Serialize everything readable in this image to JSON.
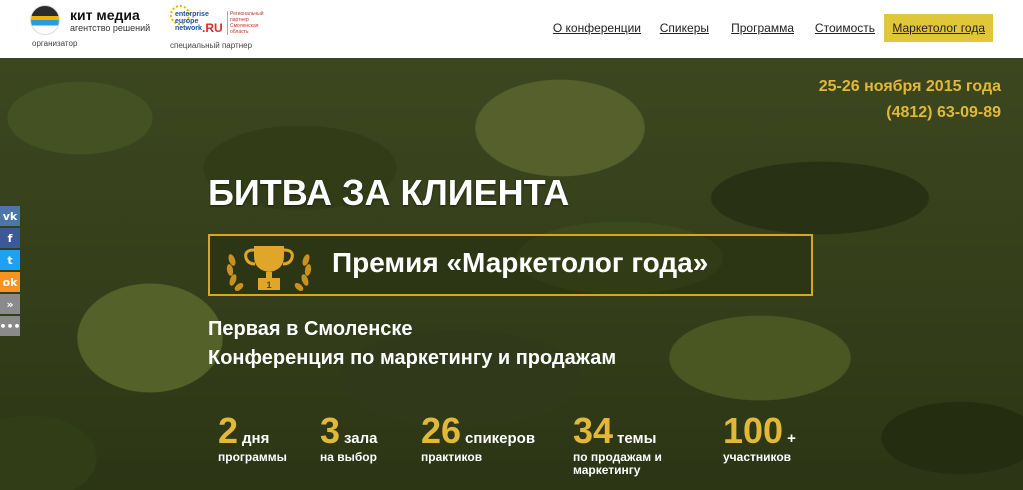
{
  "header": {
    "organizer": {
      "name": "кит медиа",
      "tagline": "агентство решений",
      "caption": "организатор"
    },
    "partner": {
      "logo_line1": "enterprise europe network",
      "logo_ru": ".RU",
      "logo_side": "Региональный партнер Смоленская область",
      "caption": "специальный партнер"
    },
    "nav": [
      {
        "label": "О конференции"
      },
      {
        "label": "Спикеры"
      },
      {
        "label": "Программа"
      },
      {
        "label": "Стоимость"
      },
      {
        "label": "Маркетолог года",
        "active": true
      }
    ],
    "accent_color": "#e2c63a"
  },
  "hero": {
    "date": "25-26 ноября 2015 года",
    "phone": "(4812) 63-09-89",
    "title": "БИТВА ЗА КЛИЕНТА",
    "award": {
      "text": "Премия «Маркетолог года»",
      "trophy_number": "1"
    },
    "subtitle_1": "Первая в Смоленске",
    "subtitle_2": "Конференция по маркетингу и продажам",
    "stats": [
      {
        "num": "2",
        "unit": "дня",
        "desc": "программы"
      },
      {
        "num": "3",
        "unit": "зала",
        "desc": "на выбор"
      },
      {
        "num": "26",
        "unit": "спикеров",
        "desc": "практиков"
      },
      {
        "num": "34",
        "unit": "темы",
        "desc_1": "по продажам и",
        "desc_2": "маркетингу"
      },
      {
        "num": "100",
        "unit": "+",
        "desc": "участников"
      }
    ],
    "highlight_color": "#e2b838"
  },
  "social": [
    {
      "icon": "vk-icon",
      "glyph": "vk"
    },
    {
      "icon": "facebook-icon",
      "glyph": "f"
    },
    {
      "icon": "twitter-icon",
      "glyph": "t"
    },
    {
      "icon": "odnoklassniki-icon",
      "glyph": "ok"
    },
    {
      "icon": "share-up-icon",
      "glyph": "»"
    },
    {
      "icon": "more-icon",
      "glyph": "•••"
    }
  ]
}
